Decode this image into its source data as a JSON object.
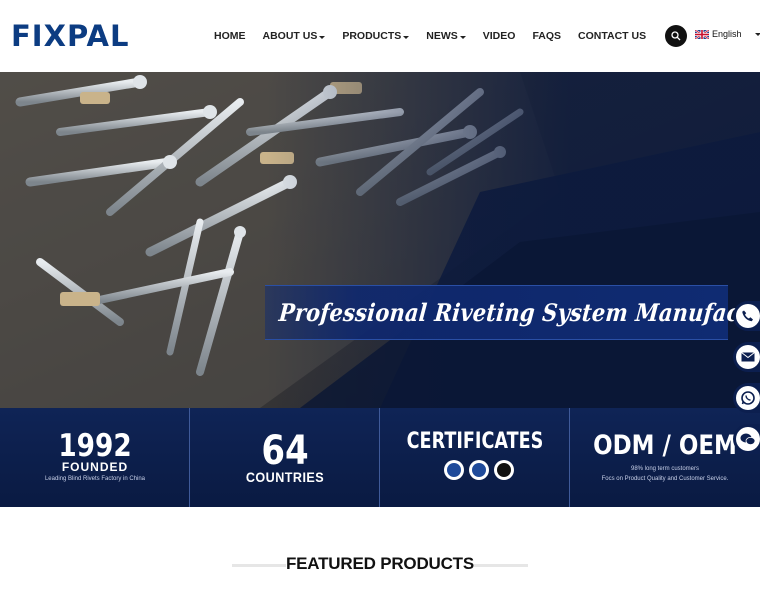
{
  "header": {
    "logo_text": "FIXPAL",
    "nav": [
      {
        "label": "HOME",
        "dropdown": false
      },
      {
        "label": "ABOUT US",
        "dropdown": true
      },
      {
        "label": "PRODUCTS",
        "dropdown": true
      },
      {
        "label": "NEWS",
        "dropdown": true
      },
      {
        "label": "VIDEO",
        "dropdown": false
      },
      {
        "label": "FAQS",
        "dropdown": false
      },
      {
        "label": "CONTACT US",
        "dropdown": false
      }
    ],
    "search_icon": "search-icon",
    "language": "English",
    "language_flag": "uk-flag-icon"
  },
  "hero": {
    "banner_text": "Professional Riveting System Manufacturer"
  },
  "stats": {
    "founded": {
      "number": "1992",
      "label": "FOUNDED",
      "note": "Leading Blind Rivets Factory in China"
    },
    "countries": {
      "number": "64",
      "label": "COUNTRIES"
    },
    "certificates": {
      "title": "CERTIFICATES",
      "badges": [
        "iso-cert-icon",
        "sgs-cert-icon",
        "ce-cert-icon"
      ]
    },
    "odm": {
      "title": "ODM / OEM",
      "line1": "98% long term customers",
      "line2": "Focs on Product Quality and Customer Service."
    }
  },
  "side_contacts": [
    "phone-icon",
    "email-icon",
    "whatsapp-icon",
    "wechat-icon"
  ],
  "featured": {
    "title": "FEATURED PRODUCTS"
  },
  "colors": {
    "brand": "#0c3c82",
    "navy": "#0c1f4f",
    "banner": "#0f2b72"
  }
}
